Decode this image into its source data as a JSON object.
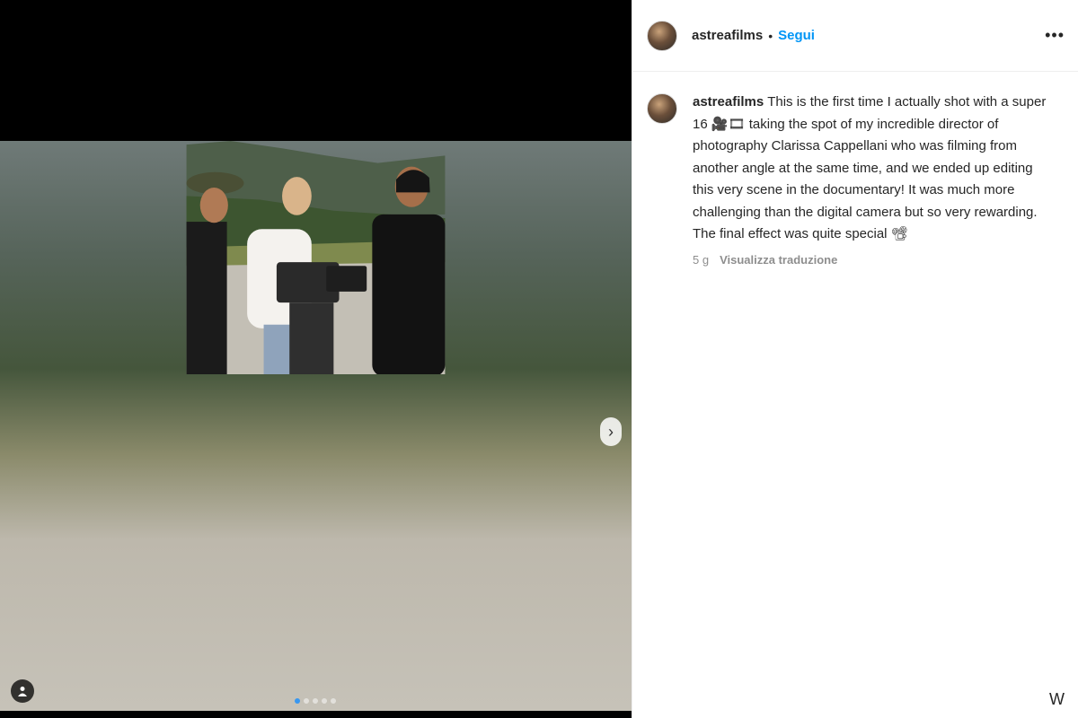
{
  "post": {
    "username": "astreafilms",
    "follow_label": "Segui",
    "separator": "•",
    "more_label": "•••",
    "next_label": "›",
    "caption_user": "astreafilms",
    "caption_text": "This is the first time I actually shot with a super 16 🎥🎞 taking the spot of my incredible director of photography Clarissa Cappellani who was filming from another angle at the same time, and we ended up editing this very scene in the documentary! It was much more challenging than the digital camera but so very rewarding. The final effect was quite special 📽",
    "time_ago": "5 g",
    "translate_label": "Visualizza traduzione",
    "carousel": {
      "count": 5,
      "active_index": 0
    },
    "bottom_icon": "W"
  },
  "icons": {
    "next": "chevron-right-icon",
    "tag": "user-tag-icon",
    "more": "more-options-icon"
  },
  "colors": {
    "follow": "#0095f6",
    "text": "#262626",
    "muted": "#8e8e8e"
  }
}
